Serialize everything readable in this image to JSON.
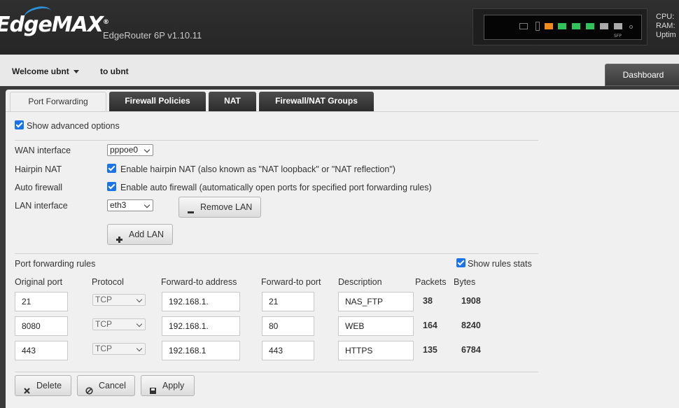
{
  "header": {
    "logo_text": "EdgeMAX",
    "logo_mark": "®",
    "product": "EdgeRouter 6P v1.10.11",
    "cpu_label": "CPU:",
    "ram_label": "RAM:",
    "uptime_label": "Uptim",
    "sfp_label": "SFP"
  },
  "userbar": {
    "welcome": "Welcome ubnt",
    "to_user": "to ubnt",
    "dashboard_tab": "Dashboard"
  },
  "tabs": [
    "Port Forwarding",
    "Firewall Policies",
    "NAT",
    "Firewall/NAT Groups"
  ],
  "advanced": {
    "label": "Show advanced options",
    "checked": true
  },
  "settings": {
    "wan_label": "WAN interface",
    "wan_value": "pppoe0",
    "hairpin_label": "Hairpin NAT",
    "hairpin_text": "Enable hairpin NAT (also known as \"NAT loopback\" or \"NAT reflection\")",
    "autofw_label": "Auto firewall",
    "autofw_text": "Enable auto firewall (automatically open ports for specified port forwarding rules)",
    "lan_label": "LAN interface",
    "lan_value": "eth3",
    "remove_lan": "Remove LAN",
    "add_lan": "Add LAN"
  },
  "rules": {
    "title": "Port forwarding rules",
    "show_stats": "Show rules stats",
    "columns": [
      "Original port",
      "Protocol",
      "Forward-to address",
      "Forward-to port",
      "Description",
      "Packets",
      "Bytes"
    ],
    "rows": [
      {
        "port": "21",
        "protocol": "TCP",
        "address": "192.168.1.",
        "fport": "21",
        "desc": "NAS_FTP",
        "packets": "38",
        "bytes": "1908"
      },
      {
        "port": "8080",
        "protocol": "TCP",
        "address": "192.168.1.",
        "fport": "80",
        "desc": "WEB",
        "packets": "164",
        "bytes": "8240"
      },
      {
        "port": "443",
        "protocol": "TCP",
        "address": "192.168.1",
        "fport": "443",
        "desc": "HTTPS",
        "packets": "135",
        "bytes": "6784"
      }
    ]
  },
  "actions": {
    "delete": "Delete",
    "cancel": "Cancel",
    "apply": "Apply"
  },
  "colors": {
    "checkbox": "#1a73e8",
    "port_orange": "#f08a1c",
    "port_green": "#2fc45a"
  }
}
